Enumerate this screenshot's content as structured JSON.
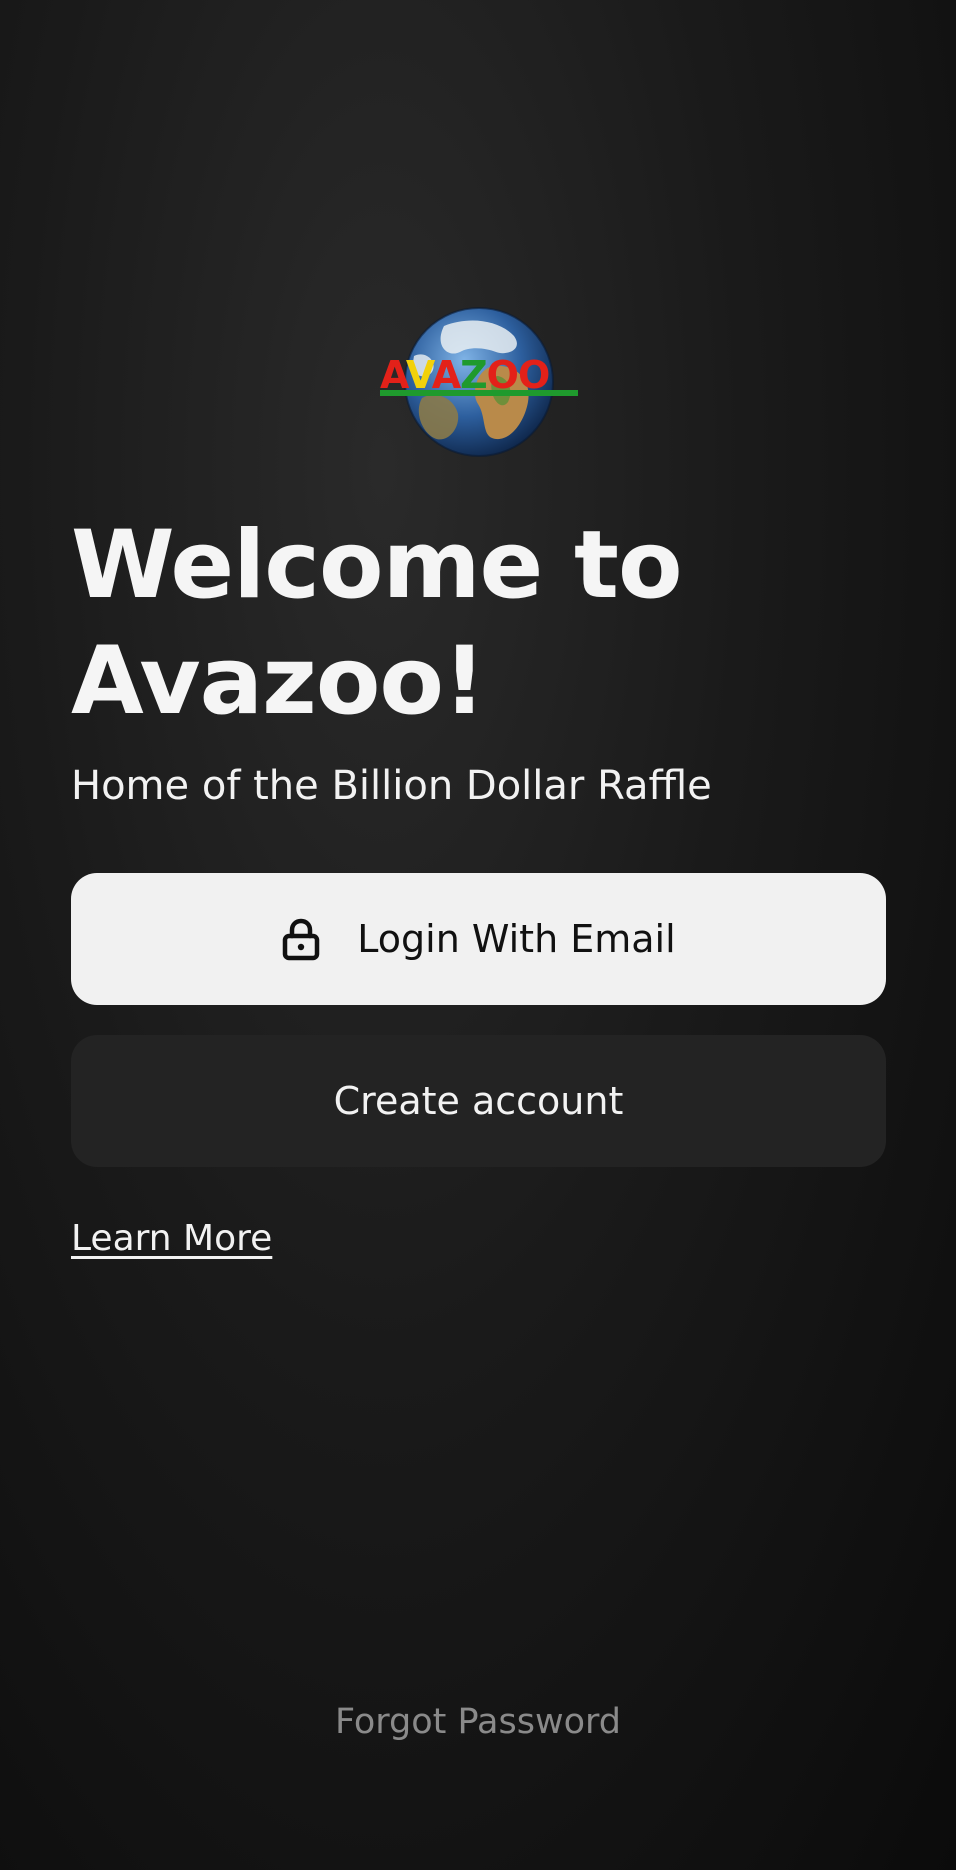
{
  "logo": {
    "text": "AVAZOO",
    "icon": "earth-globe-logo",
    "colors": [
      "#e32119",
      "#f2d10a",
      "#1f9a2d",
      "#1f5fb5",
      "#e32119",
      "#e32119"
    ]
  },
  "welcome": {
    "title_line1": "Welcome to",
    "title_line2": "Avazoo!",
    "tagline": "Home of the Billion Dollar Raffle"
  },
  "actions": {
    "login_label": "Login With Email",
    "login_icon": "lock-icon",
    "create_label": "Create account",
    "learn_more_label": "Learn More",
    "forgot_label": "Forgot Password"
  },
  "colors": {
    "background": "#161616",
    "primary_button": "#f1f1f1",
    "secondary_button": "#232323",
    "muted_text": "#8a8a8a"
  }
}
